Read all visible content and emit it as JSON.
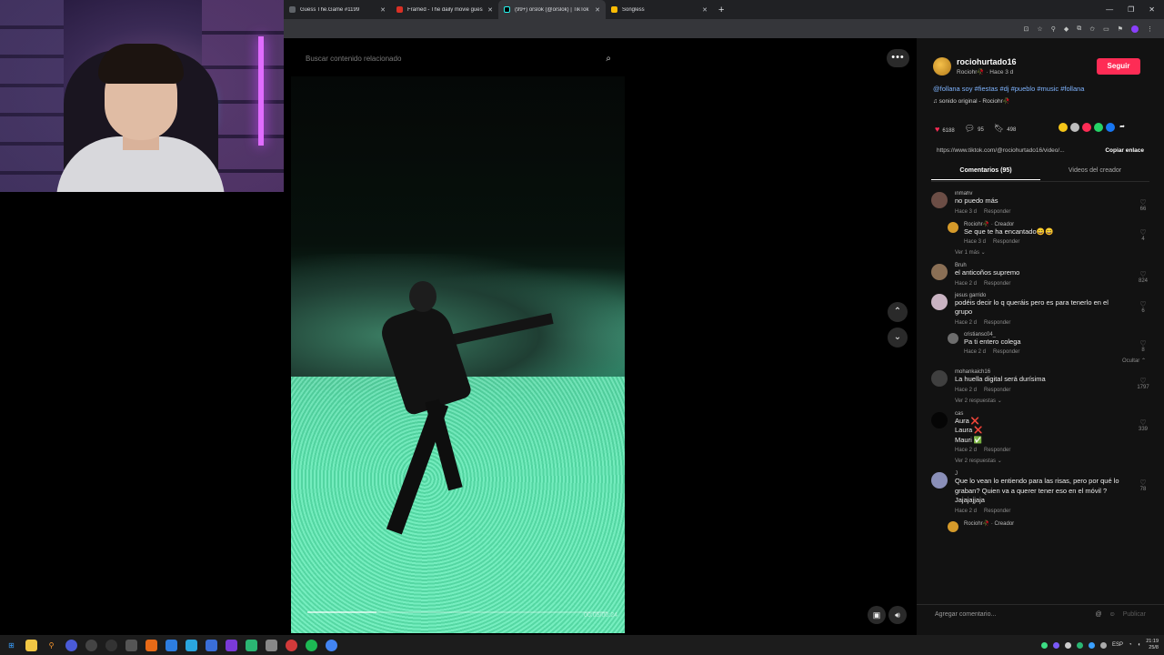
{
  "browser": {
    "tabs": [
      {
        "label": "Guess The.Game #1199",
        "color": "#5f6368",
        "active": false
      },
      {
        "label": "Framed - The daily movie guess",
        "color": "#d93025",
        "active": false
      },
      {
        "label": "(99+) orslok (@orslok) | TikTok",
        "color": "#000000",
        "active": true
      },
      {
        "label": "Songless",
        "color": "#fbbc04",
        "active": false
      }
    ],
    "new_tab": "+",
    "close": "✕"
  },
  "search": {
    "placeholder": "Buscar contenido relacionado"
  },
  "video": {
    "progress": 0.23,
    "timecode": "00:05/00:24"
  },
  "post": {
    "username": "rociohurtado16",
    "subline": "Rociohr🥀 · Hace 3 d",
    "follow_label": "Seguir",
    "description": "@follana soy #fiestas #dj #pueblo #music #follana",
    "sound": "♫ sonido original - Rociohr🥀",
    "likes": "6188",
    "comments_count": "95",
    "saves": "498",
    "link": "https://www.tiktok.com/@rociohurtado16/video/...",
    "copy_link": "Copiar enlace",
    "tab_comments": "Comentarios (95)",
    "tab_videos": "Videos del creador"
  },
  "comments": [
    {
      "user": "inmahv",
      "text": "no puedo más",
      "time": "Hace 3 d",
      "reply": "Responder",
      "likes": "66",
      "avatar": "#6b4d45"
    },
    {
      "user": "Rociohr🥀 · Creador",
      "text": "Se que te ha encantado😄😄",
      "time": "Hace 3 d",
      "reply": "Responder",
      "likes": "4",
      "avatar": "#d59a2a",
      "is_reply": true
    },
    {
      "user": "Bruh",
      "text": "el anticoños supremo",
      "time": "Hace 2 d",
      "reply": "Responder",
      "likes": "824",
      "avatar": "#8a6f55"
    },
    {
      "user": "jesus garrido",
      "text": "podéis decir lo q queráis pero es para tenerlo en el grupo",
      "time": "Hace 2 d",
      "reply": "Responder",
      "likes": "6",
      "avatar": "#c9b3c2"
    },
    {
      "user": "cristiansc04_",
      "text": "Pa ti entero colega",
      "time": "Hace 2 d",
      "reply": "Responder",
      "likes": "8",
      "avatar": "#6d6d6d",
      "is_reply": true
    },
    {
      "user": "mohankaich16",
      "text": "La huella digital será durísima",
      "time": "Hace 2 d",
      "reply": "Responder",
      "likes": "1797",
      "avatar": "#3f3f3f"
    },
    {
      "user": "cas",
      "text": "Aura ❌ Laura ❌ Mauri ✅",
      "time": "Hace 2 d",
      "reply": "Responder",
      "likes": "339",
      "avatar": "#050505"
    },
    {
      "user": "J",
      "text": "Que lo vean lo entiendo para las risas, pero por qué lo graban? Quien va a querer tener eso en el móvil ? Jajajajjaja",
      "time": "Hace 2 d",
      "reply": "Responder",
      "likes": "78",
      "avatar": "#8a8fb8"
    },
    {
      "user": "Rociohr🥀 · Creador",
      "text": "",
      "time": "",
      "reply": "",
      "likes": "",
      "avatar": "#d59a2a",
      "is_reply": true
    }
  ],
  "more_labels": {
    "view_more_1": "Ver 1 más ⌄",
    "hide": "Ocultar ⌃",
    "view_replies_a": "Ver 2 respuestas ⌄",
    "view_replies_b": "Ver 2 respuestas ⌄"
  },
  "composer": {
    "placeholder": "Agregar comentario...",
    "publish": "Publicar"
  },
  "taskbar": {
    "lang": "ESP",
    "time": "21:19",
    "date": "25/8"
  }
}
